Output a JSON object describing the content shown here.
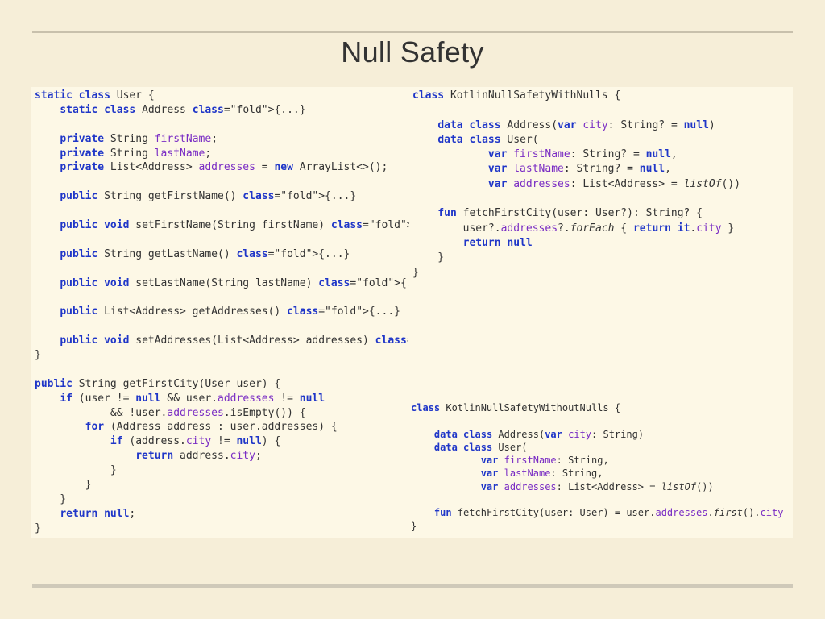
{
  "slide": {
    "title": "Null Safety"
  },
  "code": {
    "java_lines": [
      "static class User {",
      "    static class Address {...}",
      "",
      "    private String firstName;",
      "    private String lastName;",
      "    private List<Address> addresses = new ArrayList<>();",
      "",
      "    public String getFirstName() {...}",
      "",
      "    public void setFirstName(String firstName) {...}",
      "",
      "    public String getLastName() {...}",
      "",
      "    public void setLastName(String lastName) {...}",
      "",
      "    public List<Address> getAddresses() {...}",
      "",
      "    public void setAddresses(List<Address> addresses) {...}",
      "}",
      "",
      "public String getFirstCity(User user) {",
      "    if (user != null && user.addresses != null",
      "            && !user.addresses.isEmpty()) {",
      "        for (Address address : user.addresses) {",
      "            if (address.city != null) {",
      "                return address.city;",
      "            }",
      "        }",
      "    }",
      "    return null;",
      "}"
    ],
    "kotlin_with_nulls_lines": [
      "class KotlinNullSafetyWithNulls {",
      "",
      "    data class Address(var city: String? = null)",
      "    data class User(",
      "            var firstName: String? = null,",
      "            var lastName: String? = null,",
      "            var addresses: List<Address> = listOf())",
      "",
      "    fun fetchFirstCity(user: User?): String? {",
      "        user?.addresses?.forEach { return it.city }",
      "        return null",
      "    }",
      "}"
    ],
    "kotlin_without_nulls_lines": [
      "class KotlinNullSafetyWithoutNulls {",
      "",
      "    data class Address(var city: String)",
      "    data class User(",
      "            var firstName: String,",
      "            var lastName: String,",
      "            var addresses: List<Address> = listOf())",
      "",
      "    fun fetchFirstCity(user: User) = user.addresses.first().city",
      "}"
    ]
  }
}
